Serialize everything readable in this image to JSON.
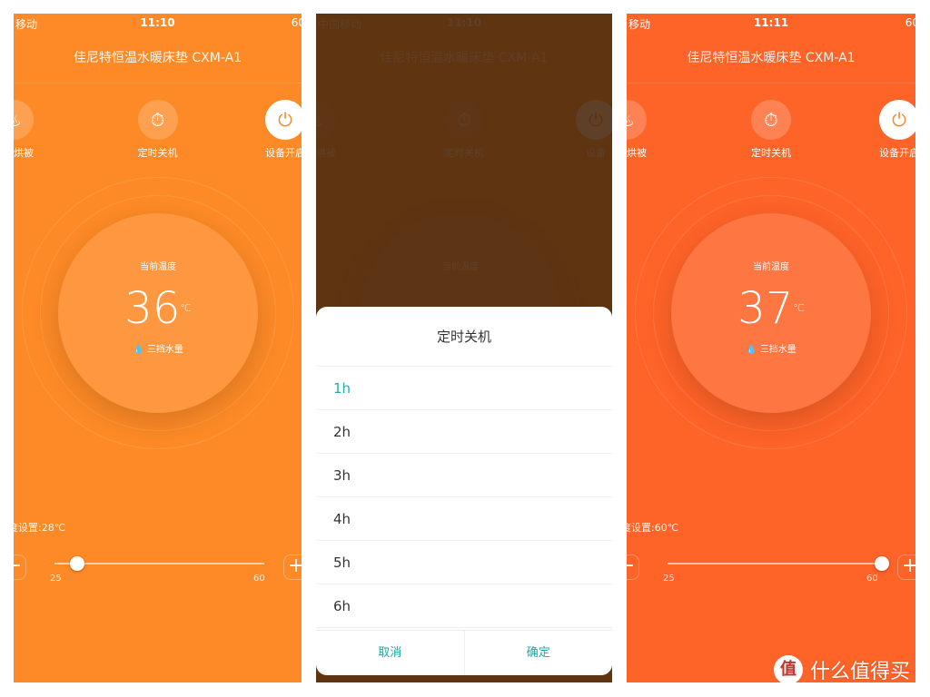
{
  "colors": {
    "panel1": "#fd8a26",
    "panel3": "#fe6328",
    "overlay": "#4d2a10",
    "accent": "#1fb0a8"
  },
  "screens": [
    {
      "carrier": "移动",
      "time": "11:10",
      "battery": "60",
      "title": "佳尼特恒温水暖床垫 CXM-A1",
      "buttons": [
        {
          "label": "一键烘被",
          "icon": "bed-heat-icon"
        },
        {
          "label": "定时关机",
          "icon": "timer-icon"
        },
        {
          "label": "设备开启",
          "icon": "power-icon"
        }
      ],
      "current_label": "当前温度",
      "temperature": "36",
      "unit": "℃",
      "water": "三挡水量",
      "set_label": "度设置:28℃",
      "slider": {
        "min": "25",
        "max": "60",
        "value": 28
      }
    },
    {
      "carrier": "中国移动",
      "time": "11:10",
      "title": "佳尼特恒温水暖床垫 CXM-A1",
      "buttons": [
        {
          "label": "一键烘被"
        },
        {
          "label": "定时关机"
        },
        {
          "label": "设备"
        }
      ],
      "current_label": "当前温度",
      "modal": {
        "title": "定时关机",
        "options": [
          "1h",
          "2h",
          "3h",
          "4h",
          "5h",
          "6h"
        ],
        "selected": "1h",
        "cancel": "取消",
        "confirm": "确定"
      }
    },
    {
      "carrier": "移动",
      "time": "11:11",
      "battery": "60",
      "title": "佳尼特恒温水暖床垫 CXM-A1",
      "buttons": [
        {
          "label": "一键烘被",
          "icon": "bed-heat-icon"
        },
        {
          "label": "定时关机",
          "icon": "timer-icon"
        },
        {
          "label": "设备开启",
          "icon": "power-icon"
        }
      ],
      "current_label": "当前温度",
      "temperature": "37",
      "unit": "℃",
      "water": "三挡水量",
      "set_label": "度设置:60℃",
      "slider": {
        "min": "25",
        "max": "60",
        "value": 60
      }
    }
  ],
  "watermark": {
    "logo": "值",
    "text": "什么值得买"
  }
}
